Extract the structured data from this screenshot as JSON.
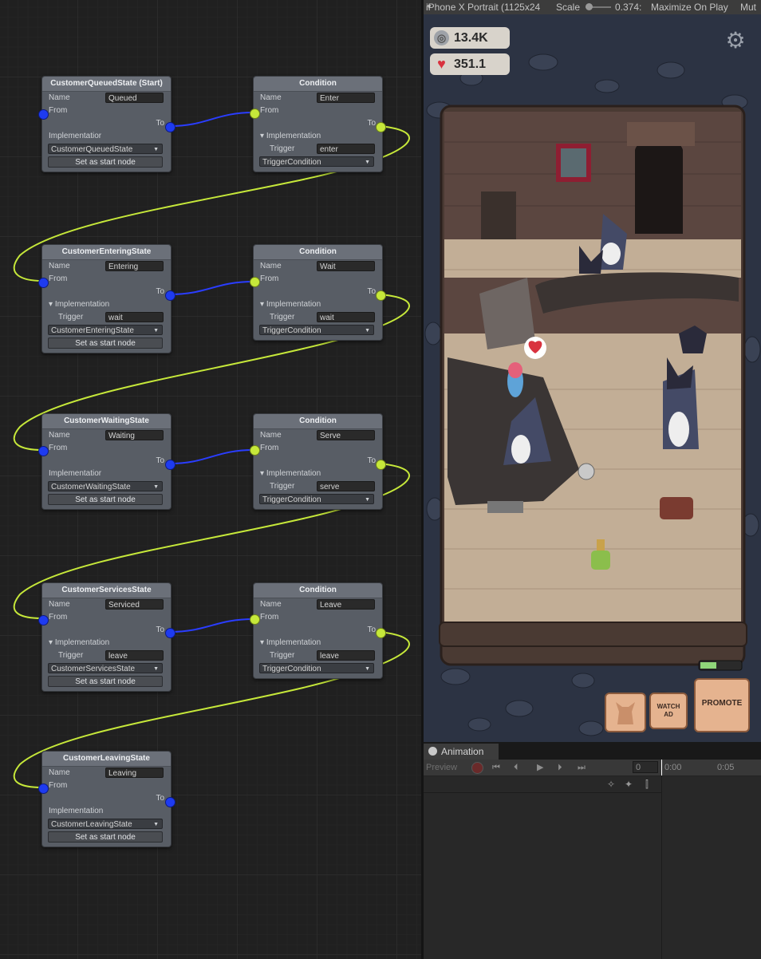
{
  "graph": {
    "nodes": [
      {
        "id": "n1",
        "title": "CustomerQueuedState (Start)",
        "name": "Queued",
        "impl_label": "Implementatior",
        "impl_value": "CustomerQueuedState",
        "start_label": "Set as start node"
      },
      {
        "id": "c1",
        "title": "Condition",
        "name": "Enter",
        "impl_label": "Implementation",
        "trigger": "enter",
        "impl_value": "TriggerCondition"
      },
      {
        "id": "n2",
        "title": "CustomerEnteringState",
        "name": "Entering",
        "impl_label": "Implementation",
        "trigger": "wait",
        "impl_value": "CustomerEnteringState",
        "start_label": "Set as start node"
      },
      {
        "id": "c2",
        "title": "Condition",
        "name": "Wait",
        "impl_label": "Implementation",
        "trigger": "wait",
        "impl_value": "TriggerCondition"
      },
      {
        "id": "n3",
        "title": "CustomerWaitingState",
        "name": "Waiting",
        "impl_label": "Implementatior",
        "impl_value": "CustomerWaitingState",
        "start_label": "Set as start node"
      },
      {
        "id": "c3",
        "title": "Condition",
        "name": "Serve",
        "impl_label": "Implementation",
        "trigger": "serve",
        "impl_value": "TriggerCondition"
      },
      {
        "id": "n4",
        "title": "CustomerServicesState",
        "name": "Serviced",
        "impl_label": "Implementation",
        "trigger": "leave",
        "impl_value": "CustomerServicesState",
        "start_label": "Set as start node"
      },
      {
        "id": "c4",
        "title": "Condition",
        "name": "Leave",
        "impl_label": "Implementation",
        "trigger": "leave",
        "impl_value": "TriggerCondition"
      },
      {
        "id": "n5",
        "title": "CustomerLeavingState",
        "name": "Leaving",
        "impl_label": "Implementation",
        "impl_value": "CustomerLeavingState",
        "start_label": "Set as start node"
      }
    ],
    "labels": {
      "name": "Name",
      "from": "From",
      "to": "To",
      "trigger": "Trigger"
    }
  },
  "game_view": {
    "toolbar": {
      "resolution": "iPhone X Portrait (1125x24",
      "scale_label": "Scale",
      "scale_value": "0.374:",
      "maximize": "Maximize On Play",
      "mute": "Mut"
    },
    "hud": {
      "coins": "13.4K",
      "hearts": "351.1"
    },
    "buttons": {
      "watch_ad_line1": "Watch",
      "watch_ad_line2": "Ad",
      "promote": "Promote"
    },
    "progress_fraction": 0.4
  },
  "animation_panel": {
    "tab": "Animation",
    "preview": "Preview",
    "frame": "0",
    "time_marks": [
      "0:00",
      "0:05"
    ]
  }
}
